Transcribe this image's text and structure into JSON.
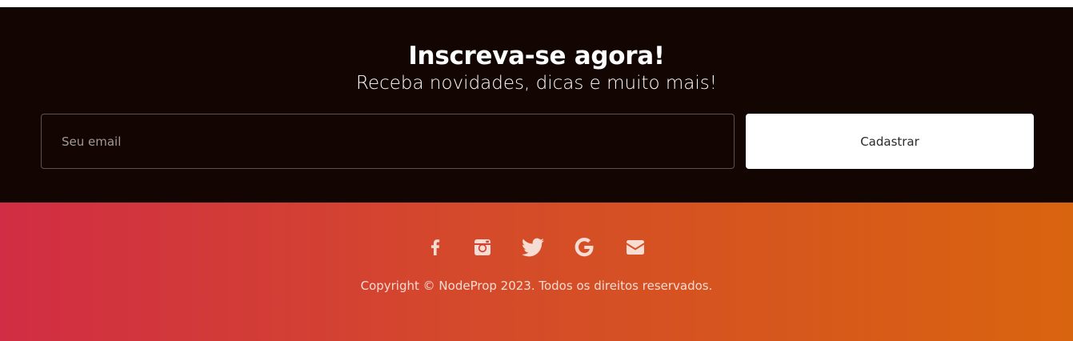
{
  "subscribe": {
    "title": "Inscreva-se agora!",
    "subtitle": "Receba novidades, dicas e muito mais!",
    "email_placeholder": "Seu email",
    "button_label": "Cadastrar"
  },
  "footer": {
    "social_icons": [
      "facebook-icon",
      "instagram-icon",
      "twitter-icon",
      "google-icon",
      "envelope-icon"
    ],
    "copyright": "Copyright © NodeProp 2023. Todos os direitos reservados."
  },
  "colors": {
    "subscribe_bg": "#130502",
    "gradient_start": "#d12d44",
    "gradient_end": "#d9640f",
    "icon_color": "#f7dcd3"
  }
}
